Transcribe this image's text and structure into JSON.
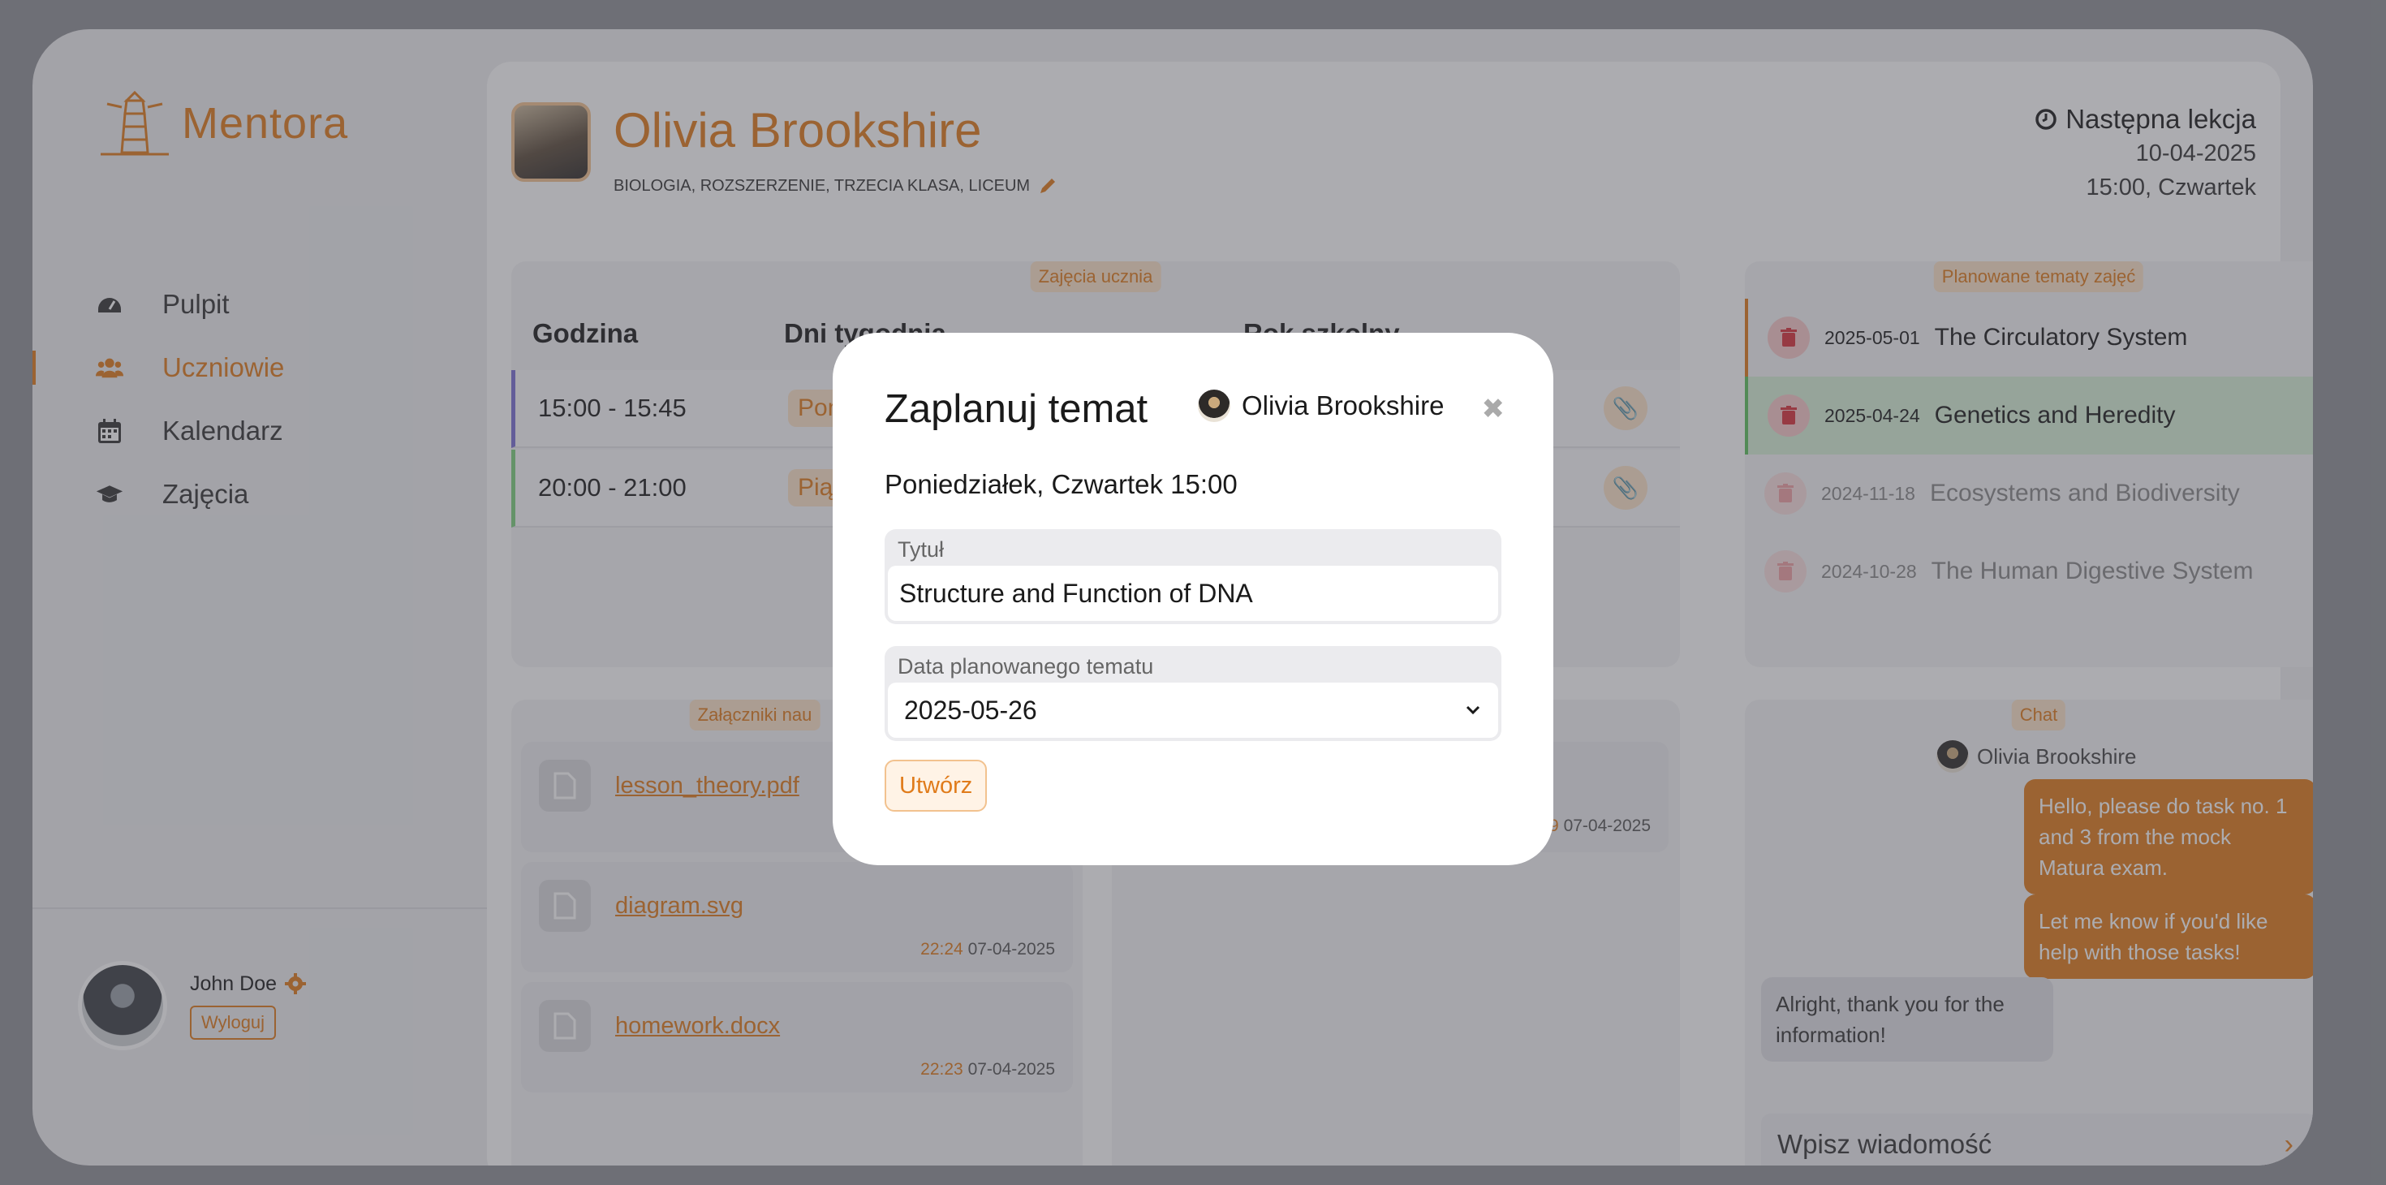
{
  "brand": {
    "name": "Mentora"
  },
  "nav": {
    "items": [
      {
        "label": "Pulpit",
        "icon": "dashboard-icon"
      },
      {
        "label": "Uczniowie",
        "icon": "users-icon"
      },
      {
        "label": "Kalendarz",
        "icon": "calendar-icon"
      },
      {
        "label": "Zajęcia",
        "icon": "graduation-cap-icon"
      }
    ],
    "active": "Uczniowie"
  },
  "user": {
    "name": "John Doe",
    "logout": "Wyloguj"
  },
  "student": {
    "name": "Olivia Brookshire",
    "tags": "BIOLOGIA, ROZSZERZENIE, TRZECIA KLASA, LICEUM"
  },
  "next_lesson": {
    "title": "Następna lekcja",
    "date": "10-04-2025",
    "time": "15:00, Czwartek"
  },
  "schedule": {
    "tag": "Zajęcia ucznia",
    "headers": [
      "Godzina",
      "Dni tygodnia",
      "Rok szkolny"
    ],
    "rows": [
      {
        "hours": "15:00 - 15:45",
        "days": "Poniedziałek",
        "shown": "Pon",
        "accent": "#7b6fd6"
      },
      {
        "hours": "20:00 - 21:00",
        "days": "Piątek",
        "shown": "Pią",
        "accent": "#7fd17f"
      }
    ]
  },
  "topics": {
    "tag": "Planowane tematy zajęć",
    "items": [
      {
        "date": "2025-05-01",
        "title": "The Circulatory System"
      },
      {
        "date": "2025-04-24",
        "title": "Genetics and Heredity"
      },
      {
        "date": "2024-11-18",
        "title": "Ecosystems and Biodiversity"
      },
      {
        "date": "2024-10-28",
        "title": "The Human Digestive System"
      }
    ]
  },
  "attachments": {
    "tag": "Załączniki nau",
    "items": [
      {
        "name": "lesson_theory.pdf",
        "time": "",
        "date": ""
      },
      {
        "name": "diagram.svg",
        "time": "22:24",
        "date": "07-04-2025"
      },
      {
        "name": "homework.docx",
        "time": "22:23",
        "date": "07-04-2025"
      }
    ]
  },
  "middle": {
    "time": "9",
    "date": "07-04-2025"
  },
  "chat": {
    "tag": "Chat",
    "contact": "Olivia Brookshire",
    "messages": [
      {
        "from": "me",
        "text": "Hello, please do task no. 1 and 3 from the mock Matura exam."
      },
      {
        "from": "me",
        "text": "Let me know if you'd like help with those tasks!"
      },
      {
        "from": "them",
        "text": "Alright, thank you for the information!"
      }
    ],
    "input_placeholder": "Wpisz wiadomość"
  },
  "modal": {
    "title": "Zaplanuj temat",
    "student": "Olivia Brookshire",
    "days": "Poniedziałek, Czwartek 15:00",
    "title_field": {
      "label": "Tytuł",
      "value": "Structure and Function of DNA"
    },
    "date_field": {
      "label": "Data planowanego tematu",
      "value": "2025-05-26"
    },
    "create": "Utwórz"
  },
  "colors": {
    "accent": "#e07b1a",
    "accent_soft": "#fde3c9",
    "success": "#5cc15c",
    "danger": "#d9303a"
  }
}
